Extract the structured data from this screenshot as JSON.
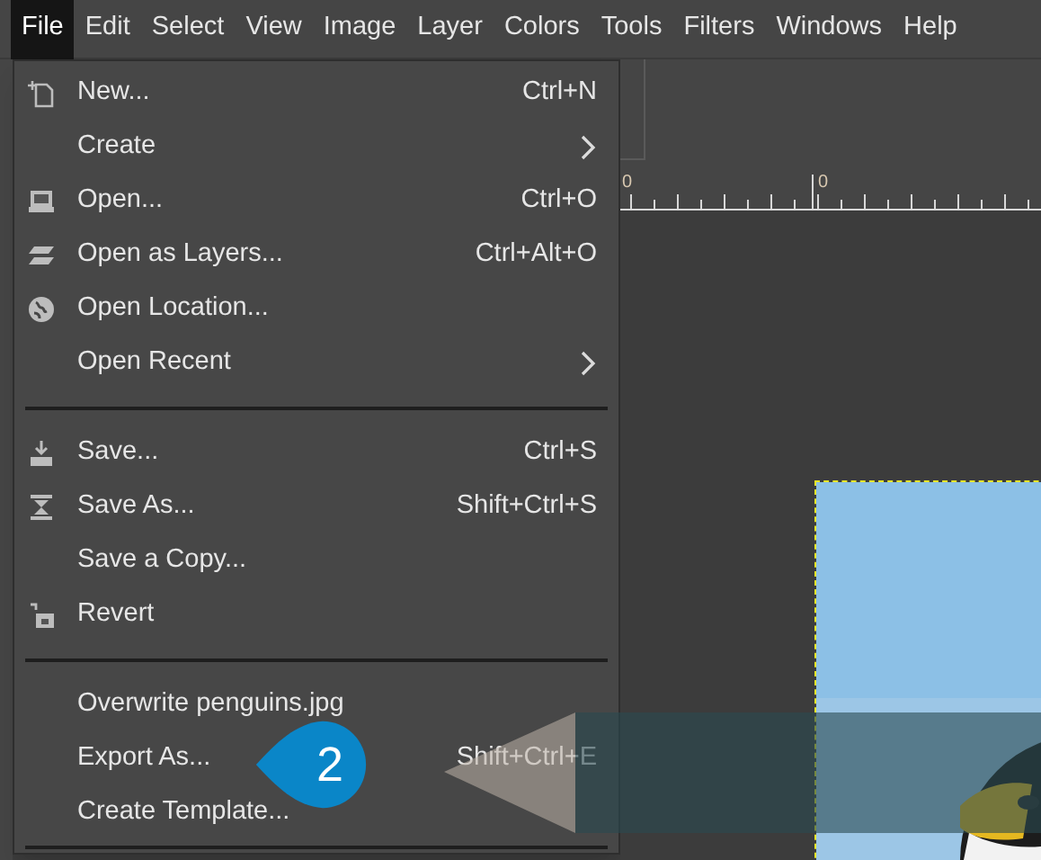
{
  "menubar": [
    {
      "label": "File",
      "selected": true
    },
    {
      "label": "Edit",
      "selected": false
    },
    {
      "label": "Select",
      "selected": false
    },
    {
      "label": "View",
      "selected": false
    },
    {
      "label": "Image",
      "selected": false
    },
    {
      "label": "Layer",
      "selected": false
    },
    {
      "label": "Colors",
      "selected": false
    },
    {
      "label": "Tools",
      "selected": false
    },
    {
      "label": "Filters",
      "selected": false
    },
    {
      "label": "Windows",
      "selected": false
    },
    {
      "label": "Help",
      "selected": false
    }
  ],
  "file_menu": [
    {
      "kind": "item",
      "label": "New...",
      "shortcut": "Ctrl+N"
    },
    {
      "kind": "item",
      "label": "Create",
      "submenu": true
    },
    {
      "kind": "item",
      "label": "Open...",
      "shortcut": "Ctrl+O"
    },
    {
      "kind": "item",
      "label": "Open as Layers...",
      "shortcut": "Ctrl+Alt+O"
    },
    {
      "kind": "item",
      "label": "Open Location..."
    },
    {
      "kind": "item",
      "label": "Open Recent",
      "submenu": true
    },
    {
      "kind": "separator"
    },
    {
      "kind": "item",
      "label": "Save...",
      "shortcut": "Ctrl+S"
    },
    {
      "kind": "item",
      "label": "Save As...",
      "shortcut": "Shift+Ctrl+S"
    },
    {
      "kind": "item",
      "label": "Save a Copy..."
    },
    {
      "kind": "item",
      "label": "Revert"
    },
    {
      "kind": "separator"
    },
    {
      "kind": "item",
      "label": "Overwrite penguins.jpg"
    },
    {
      "kind": "item",
      "label": "Export As...",
      "shortcut": "Shift+Ctrl+E"
    },
    {
      "kind": "item",
      "label": "Create Template..."
    },
    {
      "kind": "separator"
    }
  ],
  "ruler": {
    "labels": [
      "0",
      "0"
    ]
  },
  "callout": {
    "number": "2"
  }
}
